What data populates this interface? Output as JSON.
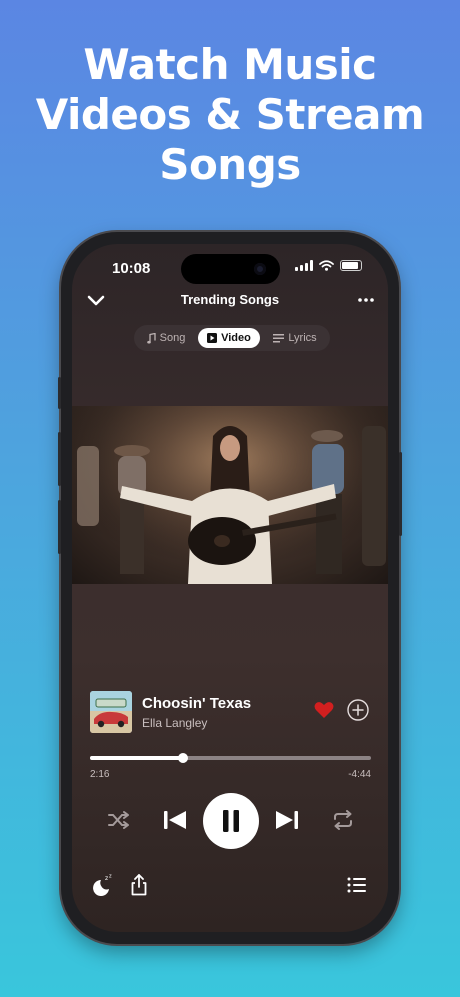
{
  "headline": {
    "line1": "Watch Music",
    "line2": "Videos & Stream",
    "line3": "Songs"
  },
  "status_bar": {
    "time": "10:08"
  },
  "header": {
    "title": "Trending Songs"
  },
  "tabs": [
    {
      "label": "Song",
      "icon": "music-note-icon",
      "active": false
    },
    {
      "label": "Video",
      "icon": "play-square-icon",
      "active": true
    },
    {
      "label": "Lyrics",
      "icon": "lyrics-icon",
      "active": false
    }
  ],
  "now_playing": {
    "title": "Choosin' Texas",
    "artist": "Ella Langley",
    "liked": true,
    "elapsed": "2:16",
    "remaining": "-4:44",
    "progress": 0.33
  },
  "colors": {
    "heart": "#d21f1f",
    "accent_white": "#ffffff"
  }
}
